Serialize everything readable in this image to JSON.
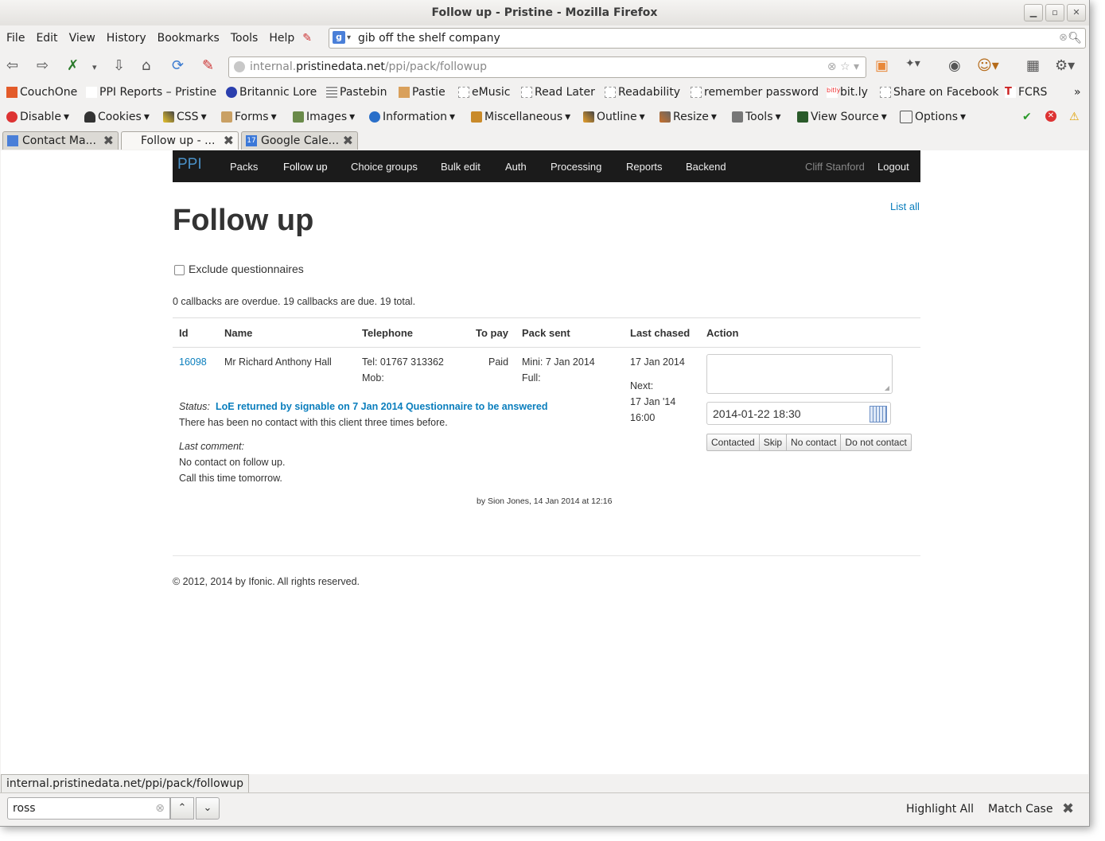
{
  "window": {
    "title": "Follow up - Pristine - Mozilla Firefox"
  },
  "menu": [
    "File",
    "Edit",
    "View",
    "History",
    "Bookmarks",
    "Tools",
    "Help"
  ],
  "search": {
    "value": "gib off the shelf company",
    "engine_icon": "google-icon"
  },
  "urlbar": {
    "host_prefix": "internal.",
    "host_main": "pristinedata.net",
    "path": "/ppi/pack/followup"
  },
  "bookmarks": [
    "CouchOne",
    "PPI Reports – Pristine",
    "Britannic Lore",
    "Pastebin",
    "Pastie",
    "eMusic",
    "Read Later",
    "Readability",
    "remember password",
    "bit.ly",
    "Share on Facebook",
    "FCRS"
  ],
  "devtoolbar": [
    "Disable",
    "Cookies",
    "CSS",
    "Forms",
    "Images",
    "Information",
    "Miscellaneous",
    "Outline",
    "Resize",
    "Tools",
    "View Source",
    "Options"
  ],
  "tabs": [
    {
      "label": "Contact Ma...",
      "active": false
    },
    {
      "label": "Follow up - ...",
      "active": true
    },
    {
      "label": "Google Cale...",
      "active": false
    }
  ],
  "topnav": {
    "brand": "PPI",
    "items": [
      "Packs",
      "Follow up",
      "Choice groups",
      "Bulk edit",
      "Auth",
      "Processing",
      "Reports",
      "Backend"
    ],
    "user": "Cliff Stanford",
    "logout": "Logout"
  },
  "page": {
    "list_all": "List all",
    "title": "Follow up",
    "exclude_label": "Exclude questionnaires",
    "summary": "0 callbacks are overdue. 19 callbacks are due. 19 total."
  },
  "table": {
    "headers": [
      "Id",
      "Name",
      "Telephone",
      "To pay",
      "Pack sent",
      "Last chased",
      "Action"
    ],
    "row": {
      "id": "16098",
      "name": "Mr Richard Anthony Hall",
      "tel": "Tel: 01767 313362",
      "mob": "Mob:",
      "to_pay": "Paid",
      "pack_mini": "Mini: 7 Jan 2014",
      "pack_full": "Full:",
      "last_chased": "17 Jan 2014",
      "next_label": "Next:",
      "next_date": "17 Jan '14",
      "next_time": "16:00",
      "status_label": "Status:",
      "status_text": "LoE returned by signable on 7 Jan 2014 Questionnaire to be answered",
      "contact_note": "There has been no contact with this client three times before.",
      "last_comment_label": "Last comment:",
      "comment_line1": "No contact on follow up.",
      "comment_line2": "Call this time tomorrow.",
      "by_line": "by Sion Jones, 14 Jan 2014 at 12:16",
      "date_value": "2014-01-22 18:30",
      "actions": [
        "Contacted",
        "Skip",
        "No contact",
        "Do not contact"
      ]
    }
  },
  "footer": "© 2012, 2014 by Ifonic. All rights reserved.",
  "status_url": "internal.pristinedata.net/ppi/pack/followup",
  "findbar": {
    "value": "ross",
    "highlight_all": "Highlight All",
    "match_case": "Match Case"
  }
}
